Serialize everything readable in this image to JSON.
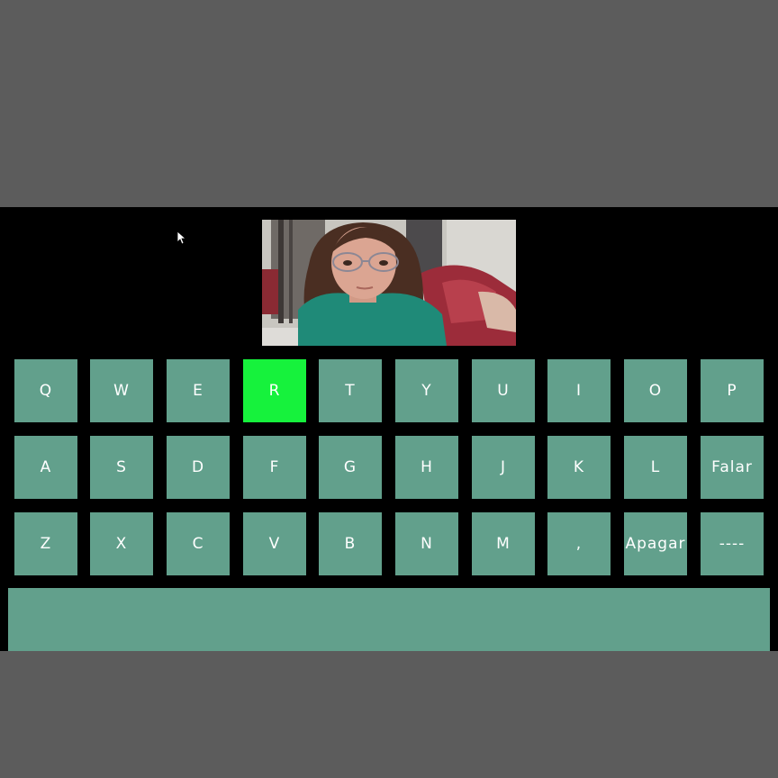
{
  "colors": {
    "key": "#62a08c",
    "key_highlight": "#16f23c",
    "background": "#000000",
    "outer": "#5c5c5c"
  },
  "keyboard": {
    "rows": [
      [
        {
          "label": "Q",
          "name": "key-q"
        },
        {
          "label": "W",
          "name": "key-w"
        },
        {
          "label": "E",
          "name": "key-e"
        },
        {
          "label": "R",
          "name": "key-r",
          "highlighted": true
        },
        {
          "label": "T",
          "name": "key-t"
        },
        {
          "label": "Y",
          "name": "key-y"
        },
        {
          "label": "U",
          "name": "key-u"
        },
        {
          "label": "I",
          "name": "key-i"
        },
        {
          "label": "O",
          "name": "key-o"
        },
        {
          "label": "P",
          "name": "key-p"
        }
      ],
      [
        {
          "label": "A",
          "name": "key-a"
        },
        {
          "label": "S",
          "name": "key-s"
        },
        {
          "label": "D",
          "name": "key-d"
        },
        {
          "label": "F",
          "name": "key-f"
        },
        {
          "label": "G",
          "name": "key-g"
        },
        {
          "label": "H",
          "name": "key-h"
        },
        {
          "label": "J",
          "name": "key-j"
        },
        {
          "label": "K",
          "name": "key-k"
        },
        {
          "label": "L",
          "name": "key-l"
        },
        {
          "label": "Falar",
          "name": "speak-button"
        }
      ],
      [
        {
          "label": "Z",
          "name": "key-z"
        },
        {
          "label": "X",
          "name": "key-x"
        },
        {
          "label": "C",
          "name": "key-c"
        },
        {
          "label": "V",
          "name": "key-v"
        },
        {
          "label": "B",
          "name": "key-b"
        },
        {
          "label": "N",
          "name": "key-n"
        },
        {
          "label": "M",
          "name": "key-m"
        },
        {
          "label": ",",
          "name": "key-comma"
        },
        {
          "label": "Apagar",
          "name": "delete-button"
        },
        {
          "label": "----",
          "name": "space-key"
        }
      ]
    ]
  },
  "text_output": {
    "value": ""
  },
  "icons": {
    "cursor": "mouse-pointer-icon",
    "camera": "webcam-feed"
  }
}
